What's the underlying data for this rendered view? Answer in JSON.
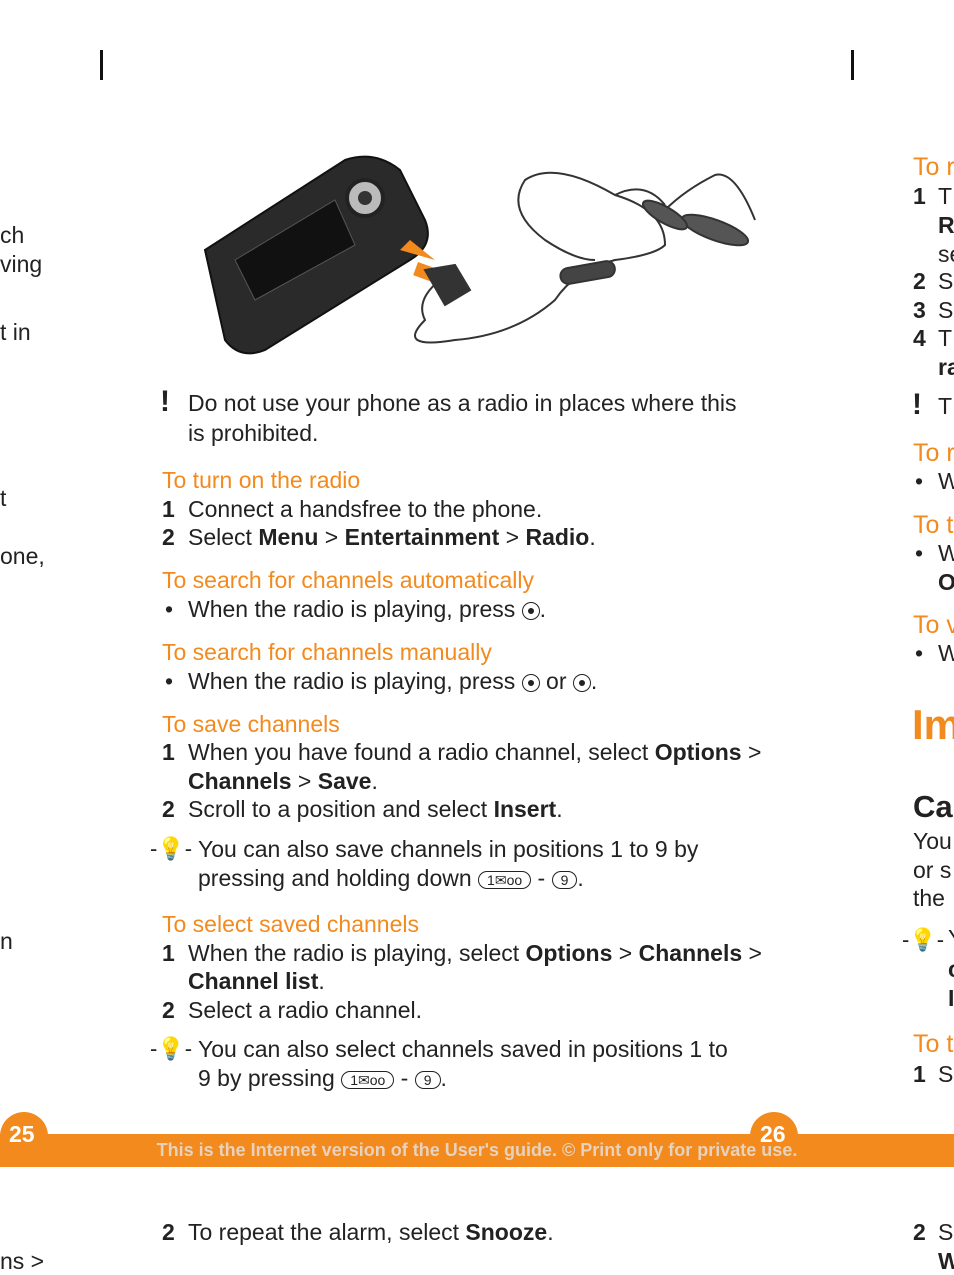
{
  "left_fragments": [
    "ch",
    "ving",
    "t in",
    "t",
    "one,",
    "n",
    "ns >"
  ],
  "warning1": {
    "line1": "Do not use your phone as a radio in places where this",
    "line2": "is prohibited."
  },
  "turn_on": {
    "heading": "To turn on the radio",
    "s1": "Connect a handsfree to the phone.",
    "s2_a": "Select ",
    "s2_b": "Menu",
    "s2_c": " > ",
    "s2_d": "Entertainment",
    "s2_e": " > ",
    "s2_f": "Radio",
    "s2_g": "."
  },
  "auto": {
    "heading": "To search for channels automatically",
    "text": "When the radio is playing, press "
  },
  "manual": {
    "heading": "To search for channels manually",
    "text": "When the radio is playing, press ",
    "or": " or "
  },
  "save": {
    "heading": "To save channels",
    "s1_a": "When you have found a radio channel, select ",
    "s1_b": "Options",
    "s1_c": " >",
    "s1_d": "Channels",
    "s1_e": " > ",
    "s1_f": "Save",
    "s1_g": ".",
    "s2_a": "Scroll to a position and select ",
    "s2_b": "Insert",
    "s2_c": "."
  },
  "tip1": {
    "line1": "You can also save channels in positions 1 to 9 by",
    "line2": "pressing and holding down ",
    "key1": "1✉oo",
    "dash": " - ",
    "key9": "9"
  },
  "select": {
    "heading": "To select saved channels",
    "s1_a": "When the radio is playing, select ",
    "s1_b": "Options",
    "s1_c": " > ",
    "s1_d": "Channels",
    "s1_e": " >",
    "s1_f": "Channel list",
    "s1_g": ".",
    "s2": "Select a radio channel."
  },
  "tip2": {
    "line1": "You can also select channels saved in positions 1 to",
    "line2": "9 by pressing ",
    "key1": "1✉oo",
    "dash": " - ",
    "key9": "9"
  },
  "footer": {
    "page_left": "25",
    "page_right": "26",
    "notice": "This is the Internet version of the User's guide. © Print only for private use."
  },
  "lower": {
    "num": "2",
    "a": "To repeat the alarm, select ",
    "b": "Snooze",
    "c": "."
  },
  "right_fragments": {
    "h1": "To r",
    "n1": "1",
    "t1": "T",
    "t1b": "R",
    "t1c": "se",
    "n2": "2",
    "t2": "S",
    "n3": "3",
    "t3": "S",
    "n4": "4",
    "t4": "T",
    "t4b": "ra",
    "w": "T",
    "h2": "To r",
    "b2": "W",
    "h3": "To t",
    "b3": "W",
    "b3b": "O",
    "h4": "To v",
    "b4": "W",
    "big": "Im",
    "sub": "Ca",
    "p1": "You",
    "p2": "or s",
    "p3": "the",
    "tip": "Y",
    "tipb": "c",
    "tipc": "I",
    "h5": "To t",
    "n5": "1",
    "t5": "S",
    "n6": "2",
    "t6": "S",
    "t6b": "W"
  },
  "colors": {
    "accent": "#f28a1e"
  }
}
